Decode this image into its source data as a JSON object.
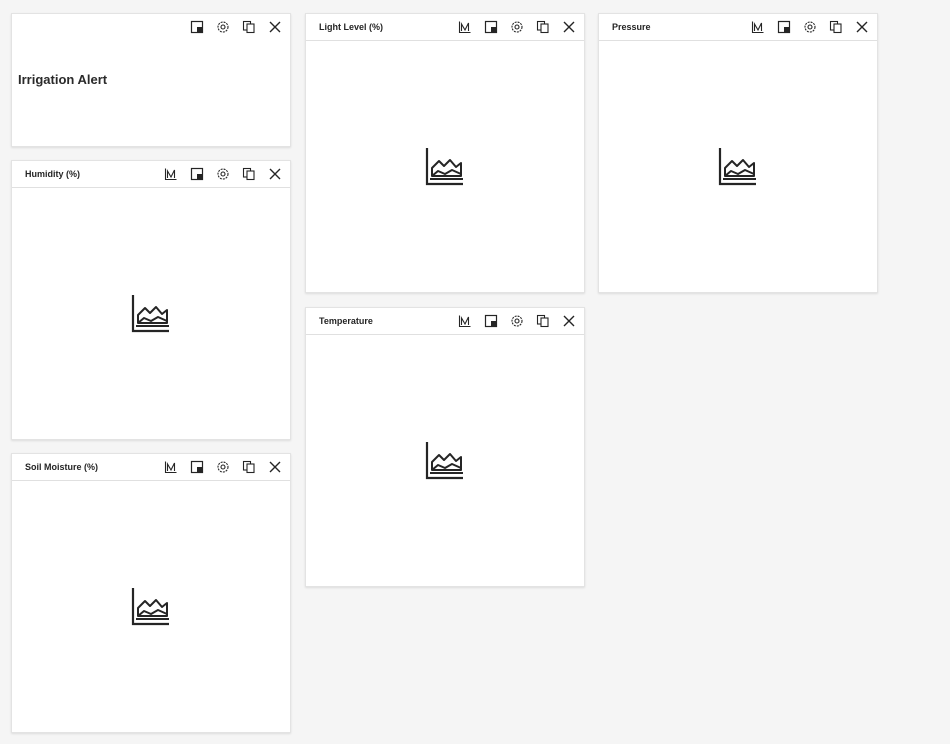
{
  "dashboard": {
    "tiles": [
      {
        "id": "irrigation-alert",
        "title": "Irrigation Alert",
        "kind": "text"
      },
      {
        "id": "light-level",
        "title": "Light Level (%)",
        "kind": "chart"
      },
      {
        "id": "pressure",
        "title": "Pressure",
        "kind": "chart"
      },
      {
        "id": "humidity",
        "title": "Humidity (%)",
        "kind": "chart"
      },
      {
        "id": "temperature",
        "title": "Temperature",
        "kind": "chart"
      },
      {
        "id": "soil-moisture",
        "title": "Soil Moisture (%)",
        "kind": "chart"
      }
    ],
    "icons": {
      "no-data-chart": "area-chart-icon",
      "actions": [
        "chart-type-icon",
        "dock-icon",
        "settings-icon",
        "copy-icon",
        "close-icon"
      ]
    },
    "colors": {
      "background": "#f5f5f5",
      "tile": "#ffffff",
      "icon": "#252525"
    }
  }
}
